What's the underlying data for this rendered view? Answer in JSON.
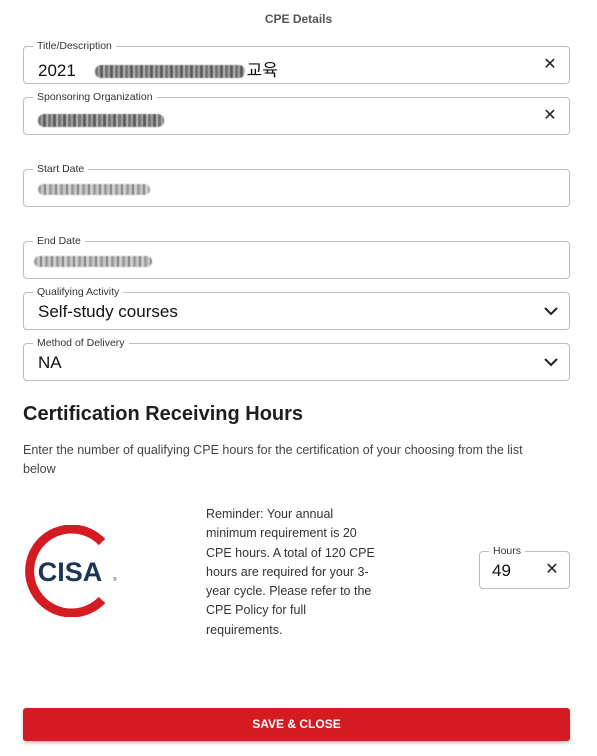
{
  "header": {
    "title": "CPE Details"
  },
  "fields": {
    "title": {
      "label": "Title/Description",
      "value_prefix": "2021",
      "value_suffix": "교육"
    },
    "sponsor": {
      "label": "Sponsoring Organization"
    },
    "start_date": {
      "label": "Start Date"
    },
    "end_date": {
      "label": "End Date"
    },
    "activity": {
      "label": "Qualifying Activity",
      "value": "Self-study courses"
    },
    "delivery": {
      "label": "Method of Delivery",
      "value": "NA"
    }
  },
  "certification": {
    "heading": "Certification Receiving Hours",
    "description": "Enter the number of qualifying CPE hours for the certification of your choosing from the list below",
    "logo_text": "CISA",
    "reminder": "Reminder: Your annual minimum requirement is 20 CPE hours. A total of 120 CPE hours are required for your 3-year cycle. Please refer to the CPE Policy for full requirements.",
    "hours": {
      "label": "Hours",
      "value": "49"
    }
  },
  "actions": {
    "save_label": "SAVE & CLOSE"
  },
  "icons": {
    "clear": "close-icon",
    "dropdown": "chevron-down-icon"
  },
  "colors": {
    "brand_red": "#d31b21",
    "logo_navy": "#1d3557"
  }
}
